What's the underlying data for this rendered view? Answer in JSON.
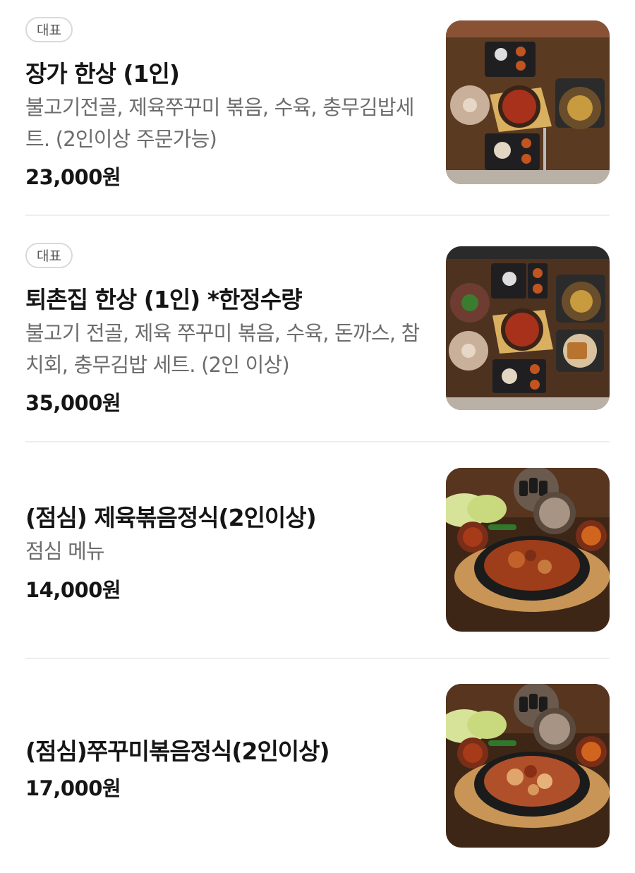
{
  "menu": {
    "items": [
      {
        "badge": "대표",
        "name": "장가 한상 (1인)",
        "description": "불고기전골, 제육쭈꾸미 볶음, 수육, 충무김밥세트. (2인이상 주문가능)",
        "price": "23,000원",
        "image_icon": "food-photo-icon"
      },
      {
        "badge": "대표",
        "name": "퇴촌집 한상 (1인) *한정수량",
        "description": "불고기 전골, 제육 쭈꾸미 볶음, 수육, 돈까스, 참치회, 충무김밥 세트. (2인 이상)",
        "price": "35,000원",
        "image_icon": "food-photo-icon"
      },
      {
        "name": "(점심) 제육볶음정식(2인이상)",
        "description": "점심 메뉴",
        "price": "14,000원",
        "image_icon": "food-photo-icon"
      },
      {
        "name": "(점심)쭈꾸미볶음정식(2인이상)",
        "price": "17,000원",
        "image_icon": "food-photo-icon"
      }
    ]
  },
  "colors": {
    "badge_border": "#d9d9d9",
    "description": "#6d6d6d",
    "divider": "#eeeeee",
    "wood_table": "#5b3a22"
  }
}
